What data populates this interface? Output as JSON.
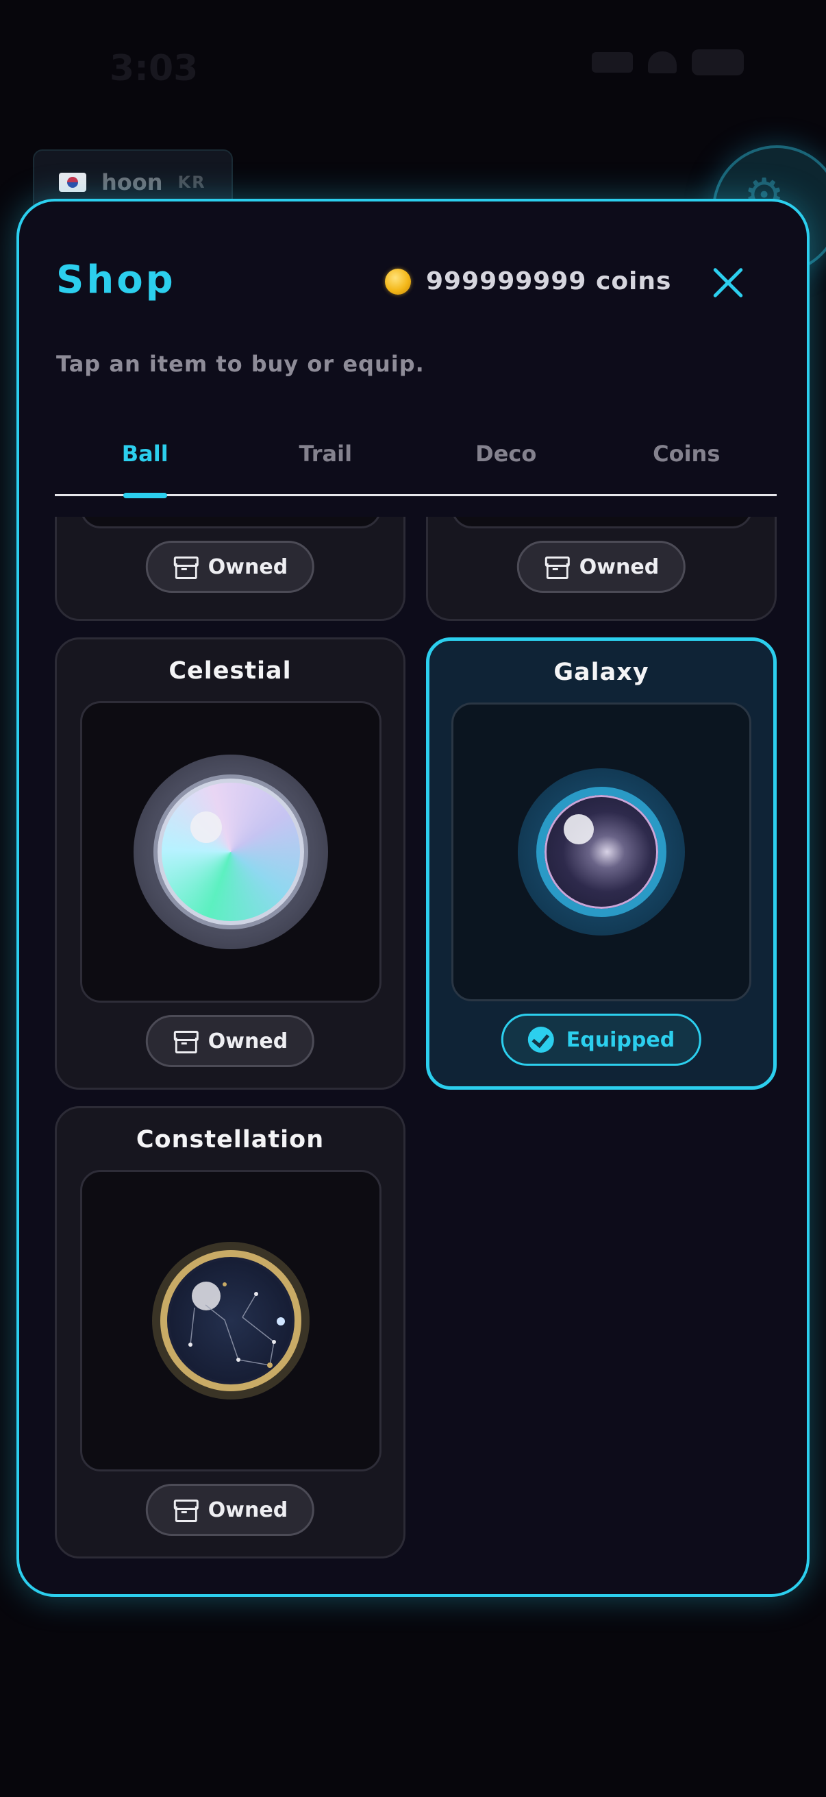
{
  "status_bar": {
    "time": "3:03"
  },
  "player": {
    "name": "hoon",
    "country": "KR"
  },
  "shop": {
    "title": "Shop",
    "coins": "999999999 coins",
    "subtitle": "Tap an item to buy or equip.",
    "tabs": [
      {
        "label": "Ball",
        "active": true
      },
      {
        "label": "Trail",
        "active": false
      },
      {
        "label": "Deco",
        "active": false
      },
      {
        "label": "Coins",
        "active": false
      }
    ],
    "items": [
      {
        "name": "",
        "status": "Owned"
      },
      {
        "name": "",
        "status": "Owned"
      },
      {
        "name": "Celestial",
        "status": "Owned"
      },
      {
        "name": "Galaxy",
        "status": "Equipped"
      },
      {
        "name": "Constellation",
        "status": "Owned"
      }
    ]
  },
  "colors": {
    "accent": "#2ccfee",
    "modal_bg": "#0d0c1a",
    "card_bg": "#17161f",
    "coin": "#f4b81a"
  },
  "icons": {
    "close": "close-icon",
    "coin": "coin-icon",
    "owned": "archive-box-icon",
    "equipped": "check-circle-icon",
    "settings": "gear-icon"
  }
}
